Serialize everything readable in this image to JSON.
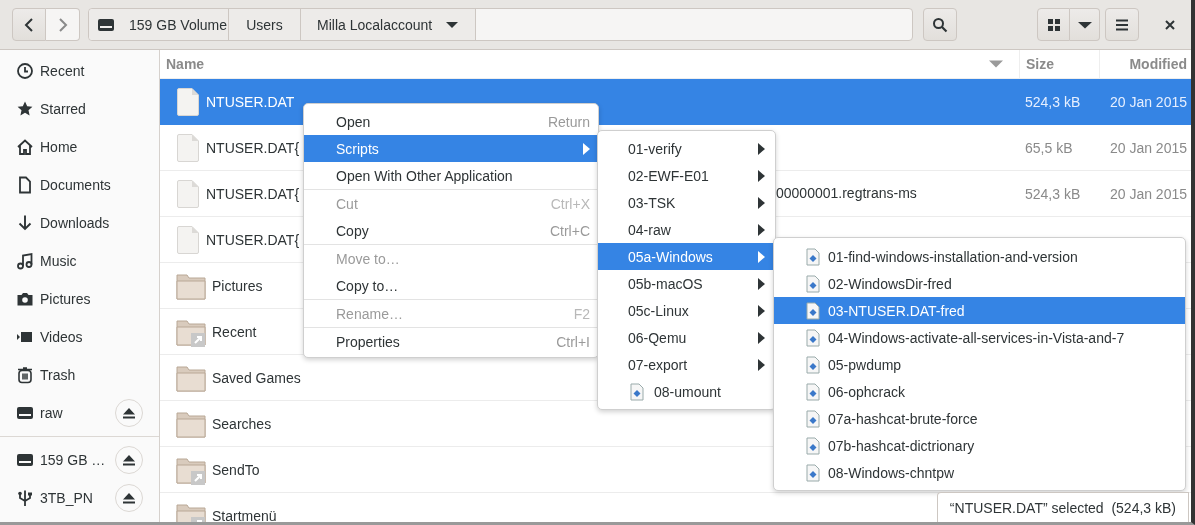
{
  "path_bar": [
    {
      "label": "159 GB Volume",
      "kind": "drive"
    },
    {
      "label": "Users",
      "kind": "plain"
    },
    {
      "label": "Milla Localaccount",
      "kind": "current"
    }
  ],
  "sidebar": {
    "groups": [
      [
        {
          "label": "Recent",
          "kind": "recent",
          "eject": false
        },
        {
          "label": "Starred",
          "kind": "starred",
          "eject": false
        },
        {
          "label": "Home",
          "kind": "home",
          "eject": false
        },
        {
          "label": "Documents",
          "kind": "documents",
          "eject": false
        },
        {
          "label": "Downloads",
          "kind": "downloads",
          "eject": false
        },
        {
          "label": "Music",
          "kind": "music",
          "eject": false
        },
        {
          "label": "Pictures",
          "kind": "pictures",
          "eject": false
        },
        {
          "label": "Videos",
          "kind": "videos",
          "eject": false
        },
        {
          "label": "Trash",
          "kind": "trash",
          "eject": false
        },
        {
          "label": "raw",
          "kind": "drive",
          "eject": true
        }
      ],
      [
        {
          "label": "159 GB …",
          "kind": "drive",
          "eject": true
        },
        {
          "label": "3TB_PN",
          "kind": "usb",
          "eject": true
        }
      ]
    ]
  },
  "columns": [
    {
      "label": "Name",
      "sorted": true
    },
    {
      "label": "Size",
      "sorted": false
    },
    {
      "label": "Modified",
      "sorted": false
    }
  ],
  "rows": [
    {
      "kind": "file",
      "name": "NTUSER.DAT",
      "size": "524,3 kB",
      "modified": "20 Jan 2015",
      "selected": true
    },
    {
      "kind": "file",
      "name": "NTUSER.DAT{",
      "size": "65,5 kB",
      "modified": "20 Jan 2015",
      "selected": false
    },
    {
      "kind": "file",
      "name": "NTUSER.DAT{",
      "name_tail": "00000001.regtrans-ms",
      "size": "524,3 kB",
      "modified": "20 Jan 2015",
      "selected": false
    },
    {
      "kind": "file",
      "name": "NTUSER.DAT{",
      "selected": false
    },
    {
      "kind": "folder",
      "name": "Pictures",
      "selected": false,
      "link": false
    },
    {
      "kind": "folder",
      "name": "Recent",
      "selected": false,
      "link": true
    },
    {
      "kind": "folder",
      "name": "Saved Games",
      "selected": false,
      "link": false
    },
    {
      "kind": "folder",
      "name": "Searches",
      "selected": false,
      "link": false
    },
    {
      "kind": "folder",
      "name": "SendTo",
      "selected": false,
      "link": true
    },
    {
      "kind": "folder",
      "name": "Startmenü",
      "selected": false,
      "link": true
    }
  ],
  "context_menu": {
    "items": [
      {
        "kind": "item",
        "label": "Open",
        "shortcut": "Return",
        "disabled": false,
        "selected": false,
        "submenu": false
      },
      {
        "kind": "item",
        "label": "Scripts",
        "disabled": false,
        "selected": true,
        "submenu": true
      },
      {
        "kind": "item",
        "label": "Open With Other Application",
        "disabled": false,
        "selected": false,
        "submenu": false
      },
      {
        "kind": "separator"
      },
      {
        "kind": "item",
        "label": "Cut",
        "shortcut": "Ctrl+X",
        "disabled": true,
        "selected": false,
        "submenu": false
      },
      {
        "kind": "item",
        "label": "Copy",
        "shortcut": "Ctrl+C",
        "disabled": false,
        "selected": false,
        "submenu": false
      },
      {
        "kind": "separator"
      },
      {
        "kind": "item",
        "label": "Move to…",
        "disabled": true,
        "selected": false,
        "submenu": false
      },
      {
        "kind": "item",
        "label": "Copy to…",
        "disabled": false,
        "selected": false,
        "submenu": false
      },
      {
        "kind": "separator"
      },
      {
        "kind": "item",
        "label": "Rename…",
        "shortcut": "F2",
        "disabled": true,
        "selected": false,
        "submenu": false
      },
      {
        "kind": "separator"
      },
      {
        "kind": "item",
        "label": "Properties",
        "shortcut": "Ctrl+I",
        "disabled": false,
        "selected": false,
        "submenu": false
      }
    ]
  },
  "scripts_menu": {
    "items": [
      {
        "label": "01-verify",
        "kind": "folder",
        "selected": false
      },
      {
        "label": "02-EWF-E01",
        "kind": "folder",
        "selected": false
      },
      {
        "label": "03-TSK",
        "kind": "folder",
        "selected": false
      },
      {
        "label": "04-raw",
        "kind": "folder",
        "selected": false
      },
      {
        "label": "05a-Windows",
        "kind": "folder",
        "selected": true
      },
      {
        "label": "05b-macOS",
        "kind": "folder",
        "selected": false
      },
      {
        "label": "05c-Linux",
        "kind": "folder",
        "selected": false
      },
      {
        "label": "06-Qemu",
        "kind": "folder",
        "selected": false
      },
      {
        "label": "07-export",
        "kind": "folder",
        "selected": false
      },
      {
        "label": "08-umount",
        "kind": "script",
        "selected": false
      }
    ]
  },
  "windows_menu": {
    "items": [
      {
        "label": "01-find-windows-installation-and-version",
        "kind": "script",
        "selected": false
      },
      {
        "label": "02-WindowsDir-fred",
        "kind": "script",
        "selected": false
      },
      {
        "label": "03-NTUSER.DAT-fred",
        "kind": "script",
        "selected": true
      },
      {
        "label": "04-Windows-activate-all-services-in-Vista-and-7",
        "kind": "script",
        "selected": false
      },
      {
        "label": "05-pwdump",
        "kind": "script",
        "selected": false
      },
      {
        "label": "06-ophcrack",
        "kind": "script",
        "selected": false
      },
      {
        "label": "07a-hashcat-brute-force",
        "kind": "script",
        "selected": false
      },
      {
        "label": "07b-hashcat-dictrionary",
        "kind": "script",
        "selected": false
      },
      {
        "label": "08-Windows-chntpw",
        "kind": "script",
        "selected": false
      }
    ]
  },
  "status": "“NTUSER.DAT” selected  (524,3 kB)"
}
